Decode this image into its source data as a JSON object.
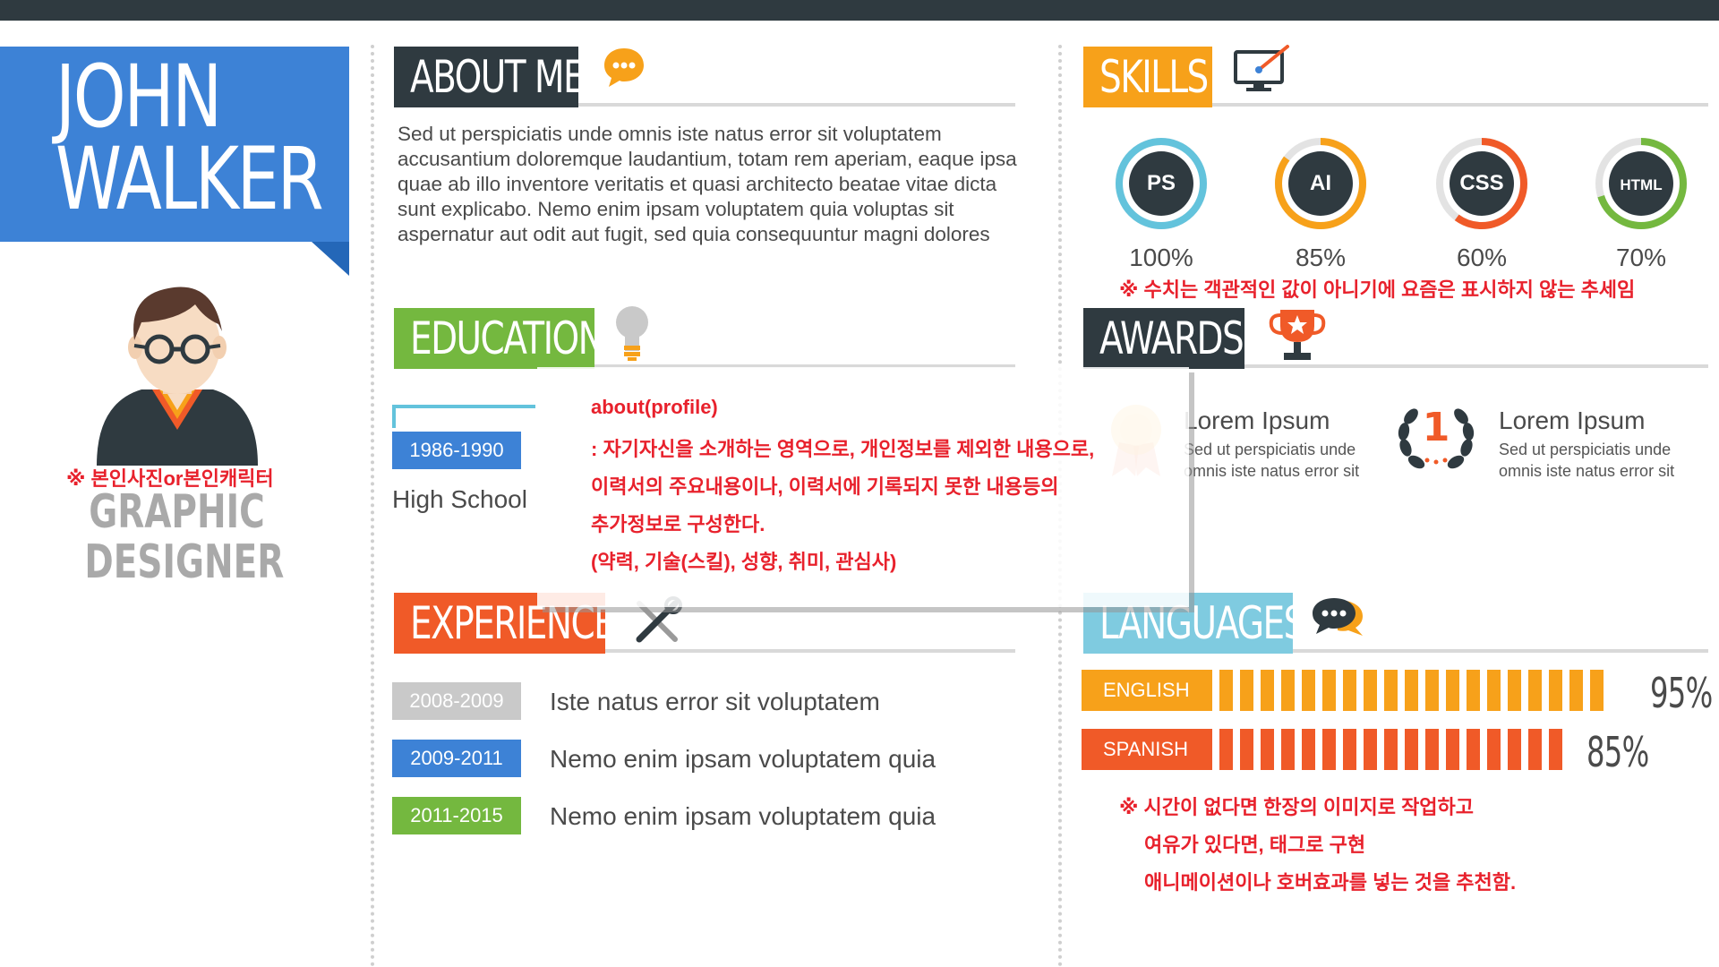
{
  "profile": {
    "first_name": "JOHN",
    "last_name": "WALKER",
    "photo_note": "※ 본인사진or본인캐릭터",
    "job_line1": "GRAPHIC",
    "job_line2": "DESIGNER"
  },
  "about": {
    "title": "ABOUT ME",
    "icon": "speech-bubble-icon",
    "text": "Sed ut perspiciatis unde omnis iste natus error sit voluptatem accusantium doloremque laudantium, totam rem aperiam, eaque ipsa quae ab illo inventore veritatis et quasi architecto beatae vitae dicta sunt explicabo. Nemo enim ipsam voluptatem quia voluptas sit aspernatur aut odit aut fugit, sed quia consequuntur magni dolores"
  },
  "education": {
    "title": "EDUCATION",
    "icon": "lightbulb-icon",
    "items": [
      {
        "years": "1986-1990",
        "school": "High School"
      }
    ]
  },
  "experience": {
    "title": "EXPERIENCE",
    "icon": "tools-icon",
    "items": [
      {
        "years": "2008-2009",
        "text": "Iste natus error sit voluptatem",
        "color": "#c9c9c9"
      },
      {
        "years": "2009-2011",
        "text": "Nemo enim ipsam voluptatem quia",
        "color": "#3d82d6"
      },
      {
        "years": "2011-2015",
        "text": "Nemo enim ipsam voluptatem quia",
        "color": "#74b83f"
      }
    ]
  },
  "skills": {
    "title": "SKILLS",
    "icon": "monitor-brush-icon",
    "items": [
      {
        "label": "PS",
        "pct_text": "100%",
        "value": 1.0,
        "color": "#63c3dc"
      },
      {
        "label": "AI",
        "pct_text": "85%",
        "value": 0.85,
        "color": "#f7a11a"
      },
      {
        "label": "CSS",
        "pct_text": "60%",
        "value": 0.6,
        "color": "#f05a28"
      },
      {
        "label": "HTML",
        "pct_text": "70%",
        "value": 0.7,
        "color": "#74b83f"
      }
    ],
    "note": "※ 수치는 객관적인 값이 아니기에 요즘은 표시하지 않는 추세임"
  },
  "awards": {
    "title": "AWARDS",
    "icon": "trophy-icon",
    "items": [
      {
        "title": "Lorem Ipsum",
        "desc": "Sed ut perspiciatis unde omnis iste natus error sit"
      },
      {
        "title": "Lorem Ipsum",
        "desc": "Sed ut perspiciatis unde omnis iste natus error sit"
      }
    ],
    "laurel_number": "1"
  },
  "languages": {
    "title": "LANGUAGES",
    "icon": "chat-bubbles-icon",
    "items": [
      {
        "name": "ENGLISH",
        "pct_text": "95%",
        "value": 0.95,
        "bars": 19,
        "color": "#f7a11a"
      },
      {
        "name": "SPANISH",
        "pct_text": "85%",
        "value": 0.85,
        "bars": 17,
        "color": "#f05a28"
      }
    ],
    "note_line1": "※ 시간이 없다면 한장의 이미지로 작업하고",
    "note_line2": "여유가 있다면, 태그로 구현",
    "note_line3": "애니메이션이나 호버효과를 넣는 것을 추천함."
  },
  "overlay": {
    "line1": "about(profile)",
    "line2": " : 자기자신을 소개하는 영역으로, 개인정보를 제외한 내용으로,",
    "line3": "이력서의 주요내용이나, 이력서에 기록되지 못한 내용등의",
    "line4": "추가정보로 구성한다.",
    "line5": "(약력, 기술(스킬), 성향, 취미, 관심사)"
  },
  "colors": {
    "dark": "#2f3a40",
    "blue": "#3d82d6",
    "green": "#74b83f",
    "orange": "#f7a11a",
    "red": "#f05a28",
    "lightblue": "#7fcbe0",
    "note_red": "#e8212c"
  }
}
